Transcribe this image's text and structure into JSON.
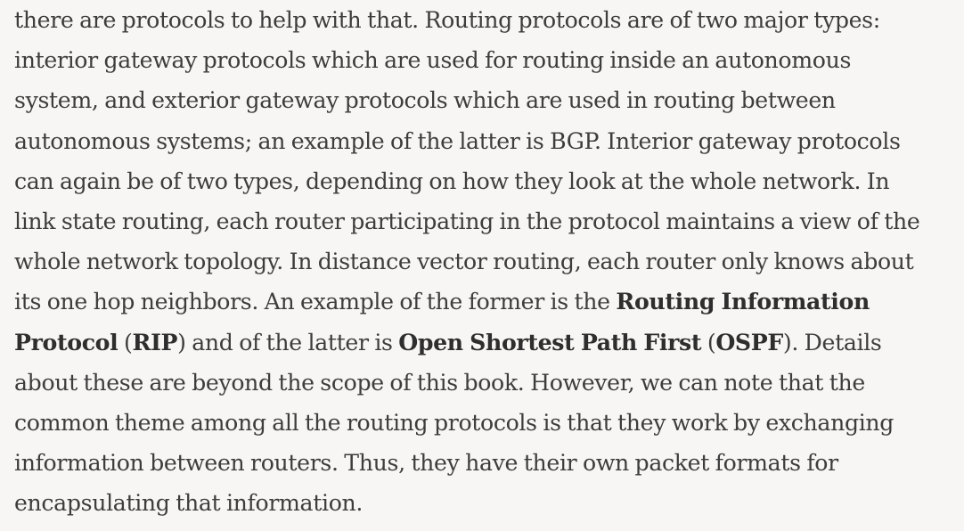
{
  "paragraph": {
    "lines": [
      [
        {
          "t": "there are protocols to help with that. Routing protocols are of two major types:"
        }
      ],
      [
        {
          "t": "interior gateway protocols which are used for routing inside an autonomous"
        }
      ],
      [
        {
          "t": "system, and exterior gateway protocols which are used in routing between"
        }
      ],
      [
        {
          "t": "autonomous systems; an example of the latter is BGP. Interior gateway protocols"
        }
      ],
      [
        {
          "t": "can again be of two types, depending on how they look at the whole network. In"
        }
      ],
      [
        {
          "t": "link state routing, each router participating in the protocol maintains a view of the"
        }
      ],
      [
        {
          "t": "whole network topology. In distance vector routing, each router only knows about"
        }
      ],
      [
        {
          "t": "its one hop neighbors. An example of the former is the "
        },
        {
          "t": "Routing Information",
          "b": true
        }
      ],
      [
        {
          "t": "Protocol",
          "b": true
        },
        {
          "t": " ("
        },
        {
          "t": "RIP",
          "b": true
        },
        {
          "t": ") and of the latter is "
        },
        {
          "t": "Open Shortest Path First",
          "b": true
        },
        {
          "t": " ("
        },
        {
          "t": "OSPF",
          "b": true
        },
        {
          "t": "). Details"
        }
      ],
      [
        {
          "t": "about these are beyond the scope of this book. However, we can note that the"
        }
      ],
      [
        {
          "t": "common theme among all the routing protocols is that they work by exchanging"
        }
      ],
      [
        {
          "t": "information between routers. Thus, they have their own packet formats for"
        }
      ],
      [
        {
          "t": "encapsulating that information."
        }
      ]
    ]
  }
}
